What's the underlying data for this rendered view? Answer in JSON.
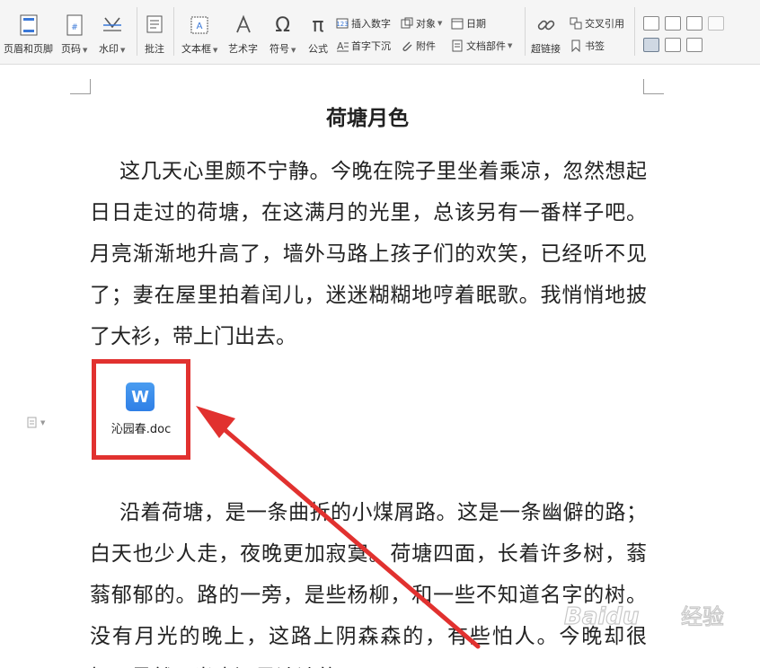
{
  "toolbar": {
    "header_footer": "页眉和页脚",
    "page_number": "页码",
    "watermark": "水印",
    "comment": "批注",
    "textbox": "文本框",
    "wordart": "艺术字",
    "symbol": "符号",
    "equation": "公式",
    "insert_number": "插入数字",
    "object": "对象",
    "date": "日期",
    "drop_cap": "首字下沉",
    "attachment": "附件",
    "doc_parts": "文档部件",
    "hyperlink": "超链接",
    "cross_ref": "交叉引用",
    "bookmark": "书签"
  },
  "document": {
    "title": "荷塘月色",
    "para1": "这几天心里颇不宁静。今晚在院子里坐着乘凉，忽然想起日日走过的荷塘，在这满月的光里，总该另有一番样子吧。月亮渐渐地升高了，墙外马路上孩子们的欢笑，已经听不见了；妻在屋里拍着闰儿，迷迷糊糊地哼着眠歌。我悄悄地披了大衫，带上门出去。",
    "attachment_name": "沁园春.doc",
    "attachment_icon_letter": "W",
    "para2": "沿着荷塘，是一条曲折的小煤屑路。这是一条幽僻的路；白天也少人走，夜晚更加寂寞。荷塘四面，长着许多树，蓊蓊郁郁的。路的一旁，是些杨柳，和一些不知道名字的树。没有月光的晚上，这路上阴森森的，有些怕人。今晚却很好，虽然月光也还是淡淡的。"
  },
  "watermark": {
    "brand": "Baidu",
    "suffix": "经验"
  },
  "colors": {
    "highlight_red": "#e1312f",
    "wps_blue": "#2f7fe6"
  }
}
